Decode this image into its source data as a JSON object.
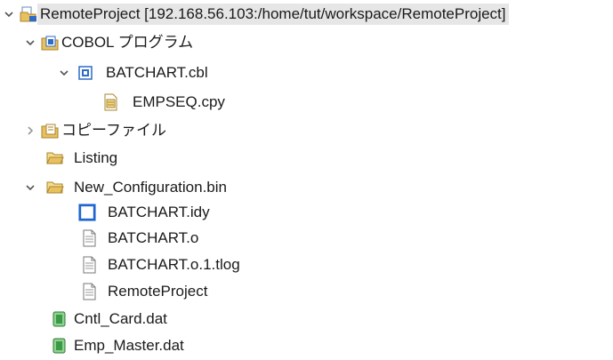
{
  "tree": {
    "root": {
      "label": "RemoteProject [192.168.56.103:/home/tut/workspace/RemoteProject]",
      "expanded": true,
      "icon": "remote-project-icon"
    },
    "items": [
      {
        "id": "cobol",
        "label": "COBOL プログラム",
        "expanded": true,
        "icon": "source-folder-icon"
      },
      {
        "id": "batchart-cbl",
        "label": "BATCHART.cbl",
        "expanded": true,
        "icon": "cobol-source-icon"
      },
      {
        "id": "empseq",
        "label": "EMPSEQ.cpy",
        "icon": "copybook-file-icon"
      },
      {
        "id": "copyfile",
        "label": "コピーファイル",
        "expanded": false,
        "icon": "copy-folder-icon"
      },
      {
        "id": "listing",
        "label": "Listing",
        "icon": "folder-icon"
      },
      {
        "id": "newconfig",
        "label": "New_Configuration.bin",
        "expanded": true,
        "icon": "folder-icon"
      },
      {
        "id": "idy",
        "label": "BATCHART.idy",
        "icon": "blank-file-icon"
      },
      {
        "id": "o",
        "label": "BATCHART.o",
        "icon": "text-file-icon"
      },
      {
        "id": "tlog",
        "label": "BATCHART.o.1.tlog",
        "icon": "text-file-icon"
      },
      {
        "id": "remoteproject-file",
        "label": "RemoteProject",
        "icon": "text-file-icon"
      },
      {
        "id": "cntl",
        "label": "Cntl_Card.dat",
        "icon": "data-file-icon"
      },
      {
        "id": "empmaster",
        "label": "Emp_Master.dat",
        "icon": "data-file-icon"
      }
    ]
  },
  "colors": {
    "selection": "#e6e6e6",
    "twisty": "#555555",
    "folder": "#e8c15e",
    "project_blue": "#2d6bc7",
    "data_green": "#3a9a45"
  }
}
